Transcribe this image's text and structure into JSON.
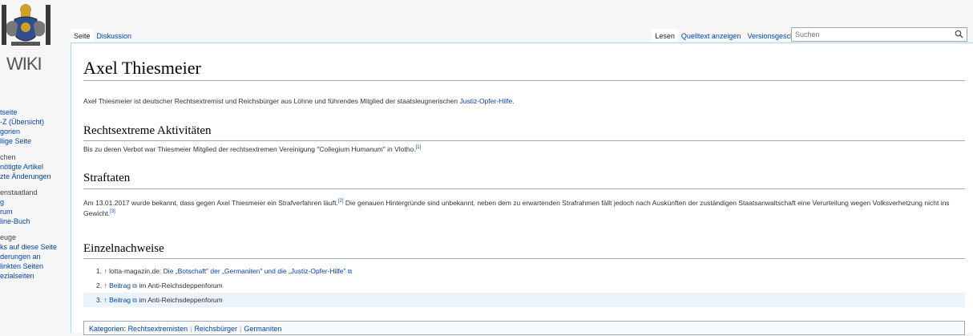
{
  "logo": {
    "text": "WIKI"
  },
  "sidebar": {
    "groups": [
      {
        "heading": "",
        "items": [
          "tseite",
          "-Z (Übersicht)",
          "gorien",
          "llige Seite"
        ]
      },
      {
        "heading": "chen",
        "items": [
          "nötigte Artikel",
          "zte Änderungen"
        ]
      },
      {
        "heading": "enstaatland",
        "items": [
          "g",
          "rum",
          "line-Buch"
        ]
      },
      {
        "heading": "euge",
        "items": [
          "ks auf diese Seite",
          "derungen an",
          "linkten Seiten",
          "ezialseiten"
        ]
      }
    ]
  },
  "tabs": {
    "page": "Seite",
    "discussion": "Diskussion",
    "read": "Lesen",
    "source": "Quelltext anzeigen",
    "history": "Versionsgeschichte"
  },
  "search": {
    "placeholder": "Suchen"
  },
  "article": {
    "title": "Axel Thiesmeier",
    "intro_text": "Axel Thiesmeier ist deutscher Rechtsextremist und Reichsbürger aus Löhne und führendes Mitglied der staatsleugnerischen",
    "intro_link": "Justiz-Opfer-Hilfe",
    "intro_end": ".",
    "section1_title": "Rechtsextreme Aktivitäten",
    "section1_text": "Bis zu deren Verbot war Thiesmeier Mitglied der rechtsextremen Vereinigung \"Collegium Humanum\" in Vlotho.",
    "section1_ref": "[1]",
    "section2_title": "Straftaten",
    "section2_text_a": "Am 13.01.2017 wurde bekannt, dass gegen Axel Thiesmeier ein Strafverfahren läuft.",
    "section2_ref_a": "[2]",
    "section2_text_b": " Die genauen Hintergründe sind unbekannt, neben dem zu erwartenden Strafrahmen fällt jedoch nach Auskünften der zuständigen Staatsanwaltschaft eine Verurteilung wegen Volksverhetzung nicht ins Gewicht.",
    "section2_ref_b": "[3]",
    "section3_title": "Einzelnachweise"
  },
  "references": [
    {
      "num": "1.",
      "arrow": "↑",
      "prefix": "lotta-magazin.de: ",
      "link": "Die „Botschaft\" der „Germaniten\" und die „Justiz-Opfer-Hilfe\"",
      "suffix": ""
    },
    {
      "num": "2.",
      "arrow": "↑",
      "prefix": "",
      "link": "Beitrag",
      "suffix": " im Anti-Reichsdeppenforum"
    },
    {
      "num": "3.",
      "arrow": "↑",
      "prefix": "",
      "link": "Beitrag",
      "suffix": " im Anti-Reichsdeppenforum"
    }
  ],
  "categories": {
    "label": "Kategorien",
    "items": [
      "Rechtsextremisten",
      "Reichsbürger",
      "Germaniten"
    ]
  },
  "colors": {
    "link": "#0645ad",
    "highlight": "#eaf3ff",
    "border": "#a7d7f9"
  }
}
